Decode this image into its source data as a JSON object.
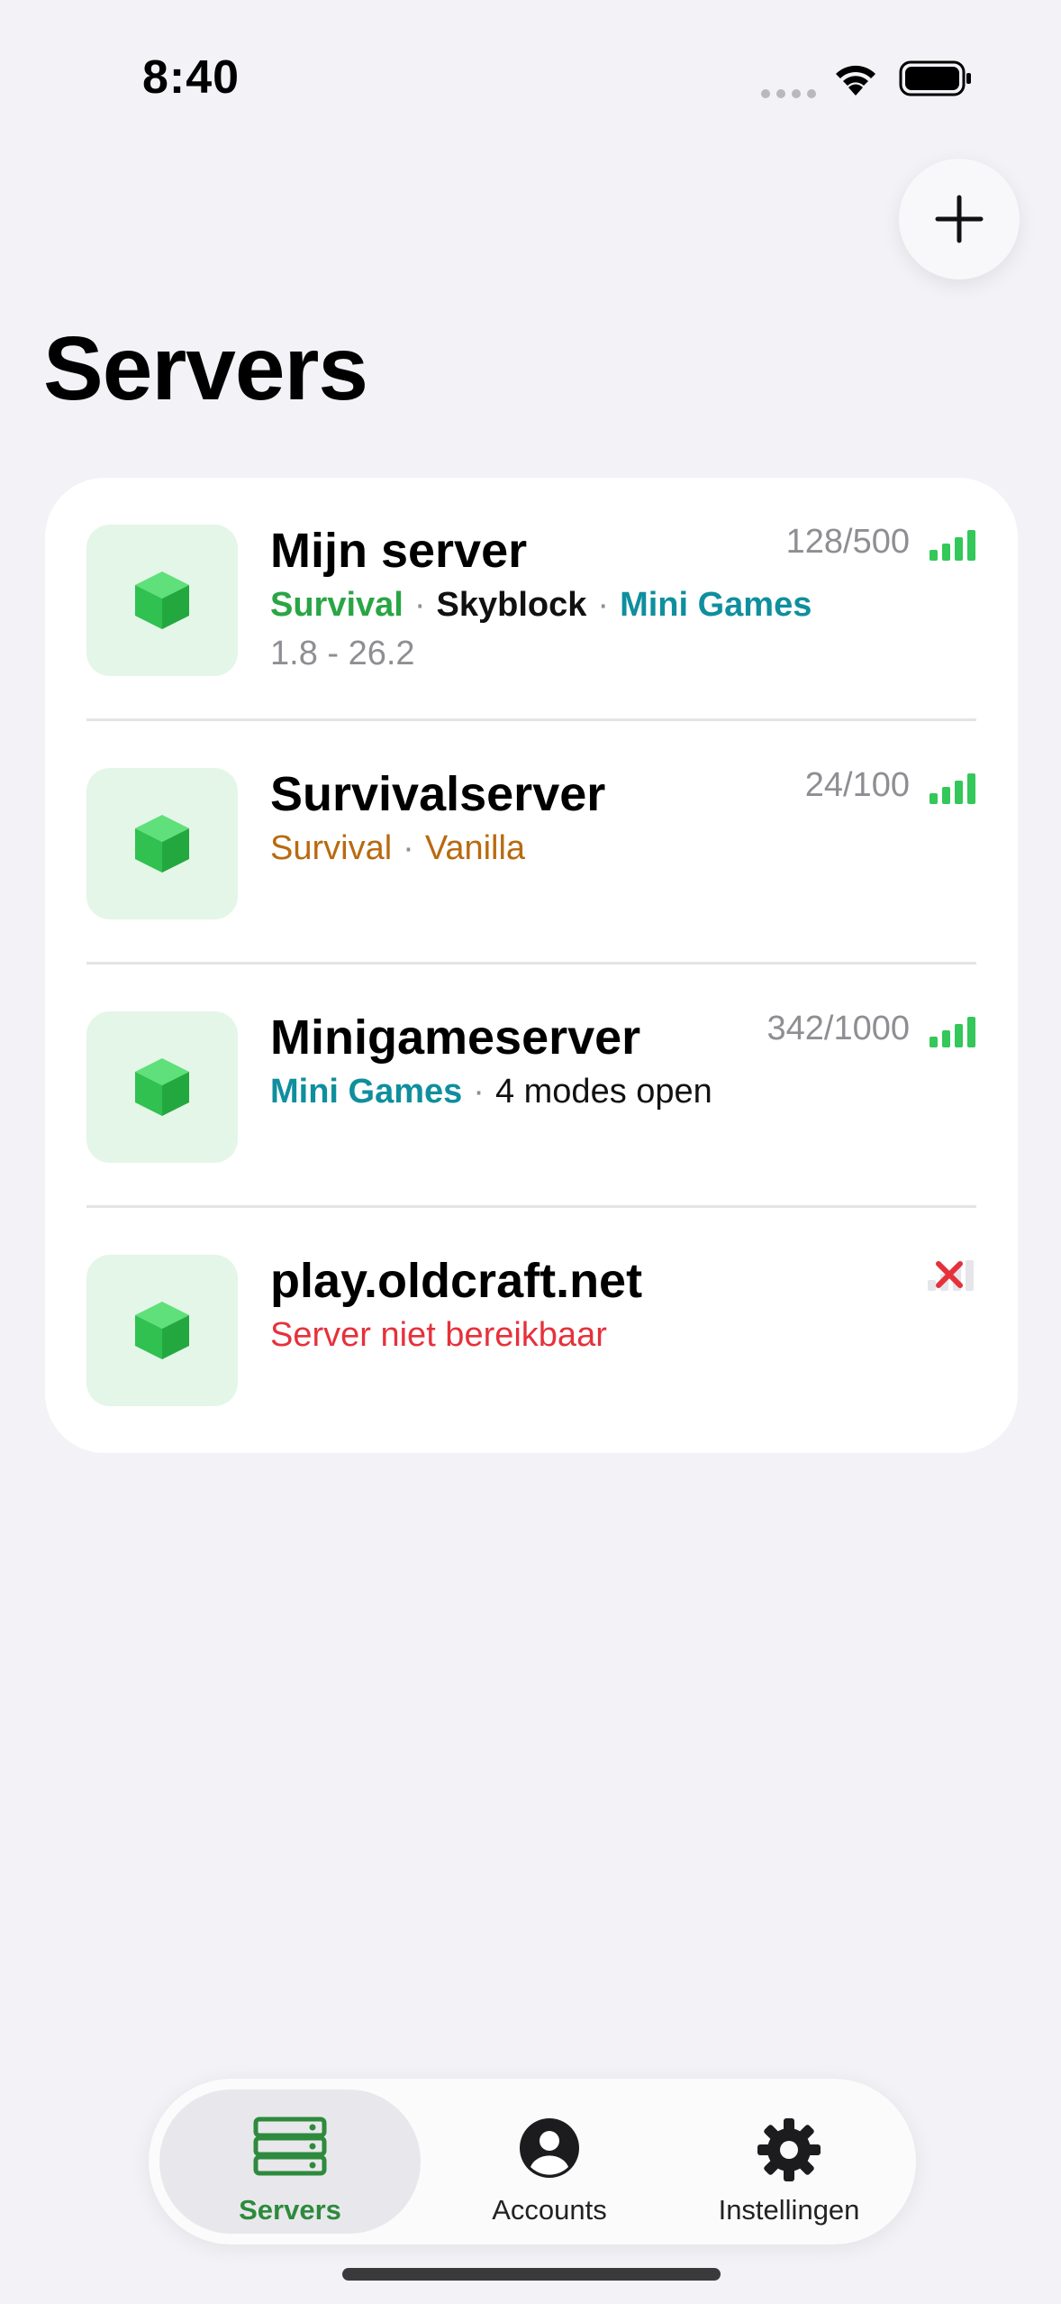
{
  "status_bar": {
    "time": "8:40"
  },
  "header": {
    "title": "Servers",
    "add_icon": "plus-icon"
  },
  "servers": [
    {
      "name": "Mijn server",
      "players": "128/500",
      "status": "online",
      "tags": [
        {
          "text": "Survival",
          "color": "#2aa544"
        },
        {
          "text": "Skyblock",
          "color": "#111111"
        },
        {
          "text": "Mini Games",
          "color": "#0f8f9e"
        }
      ],
      "version": "1.8 - 26.2"
    },
    {
      "name": "Survivalserver",
      "players": "24/100",
      "status": "online",
      "tags": [
        {
          "text": "Survival",
          "color": "#b86a10"
        },
        {
          "text": "Vanilla",
          "color": "#b86a10"
        }
      ]
    },
    {
      "name": "Minigameserver",
      "players": "342/1000",
      "status": "online",
      "tags": [
        {
          "text": "Mini Games",
          "color": "#0f8f9e"
        },
        {
          "text": "4 modes open",
          "color": "#111111"
        }
      ]
    },
    {
      "name": "play.oldcraft.net",
      "status": "offline",
      "message": "Server niet bereikbaar"
    }
  ],
  "tab_bar": {
    "tabs": [
      {
        "label": "Servers",
        "icon": "server-rack-icon",
        "active": true
      },
      {
        "label": "Accounts",
        "icon": "person-circle-icon",
        "active": false
      },
      {
        "label": "Instellingen",
        "icon": "gear-icon",
        "active": false
      }
    ]
  },
  "colors": {
    "accent_green": "#34c759",
    "tab_active": "#2e8a3c",
    "error_red": "#e6313b",
    "background": "#f2f2f7"
  }
}
